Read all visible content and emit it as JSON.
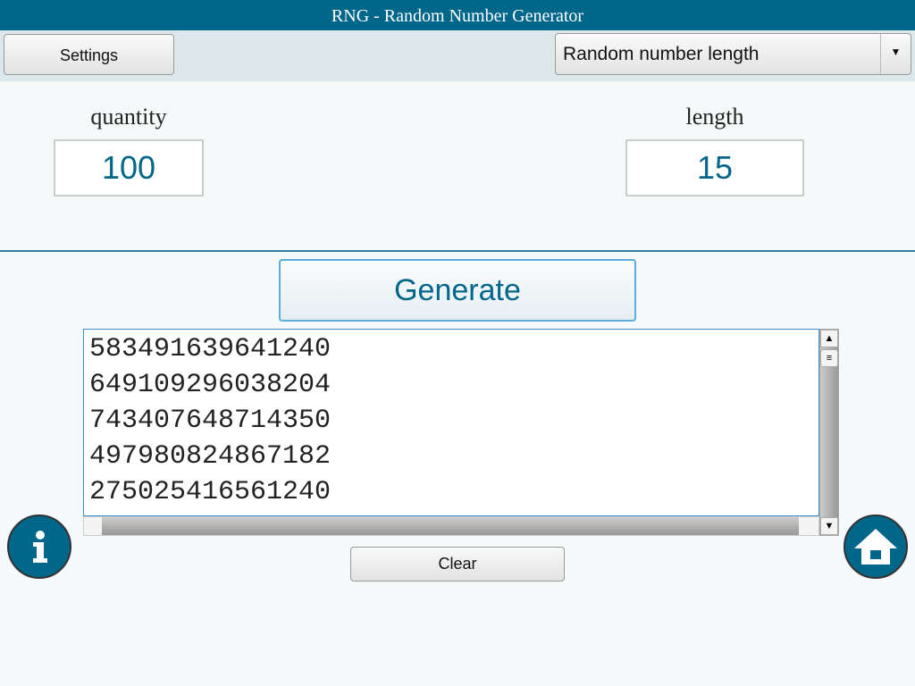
{
  "window": {
    "title": "RNG - Random Number Generator"
  },
  "toolbar": {
    "settings_label": "Settings",
    "mode_select": "Random number length"
  },
  "inputs": {
    "quantity_label": "quantity",
    "quantity_value": "100",
    "length_label": "length",
    "length_value": "15"
  },
  "actions": {
    "generate_label": "Generate",
    "clear_label": "Clear"
  },
  "results": [
    "583491639641240",
    "649109296038204",
    "743407648714350",
    "497980824867182",
    "275025416561240"
  ],
  "icons": {
    "info": "info-icon",
    "home": "home-icon"
  }
}
